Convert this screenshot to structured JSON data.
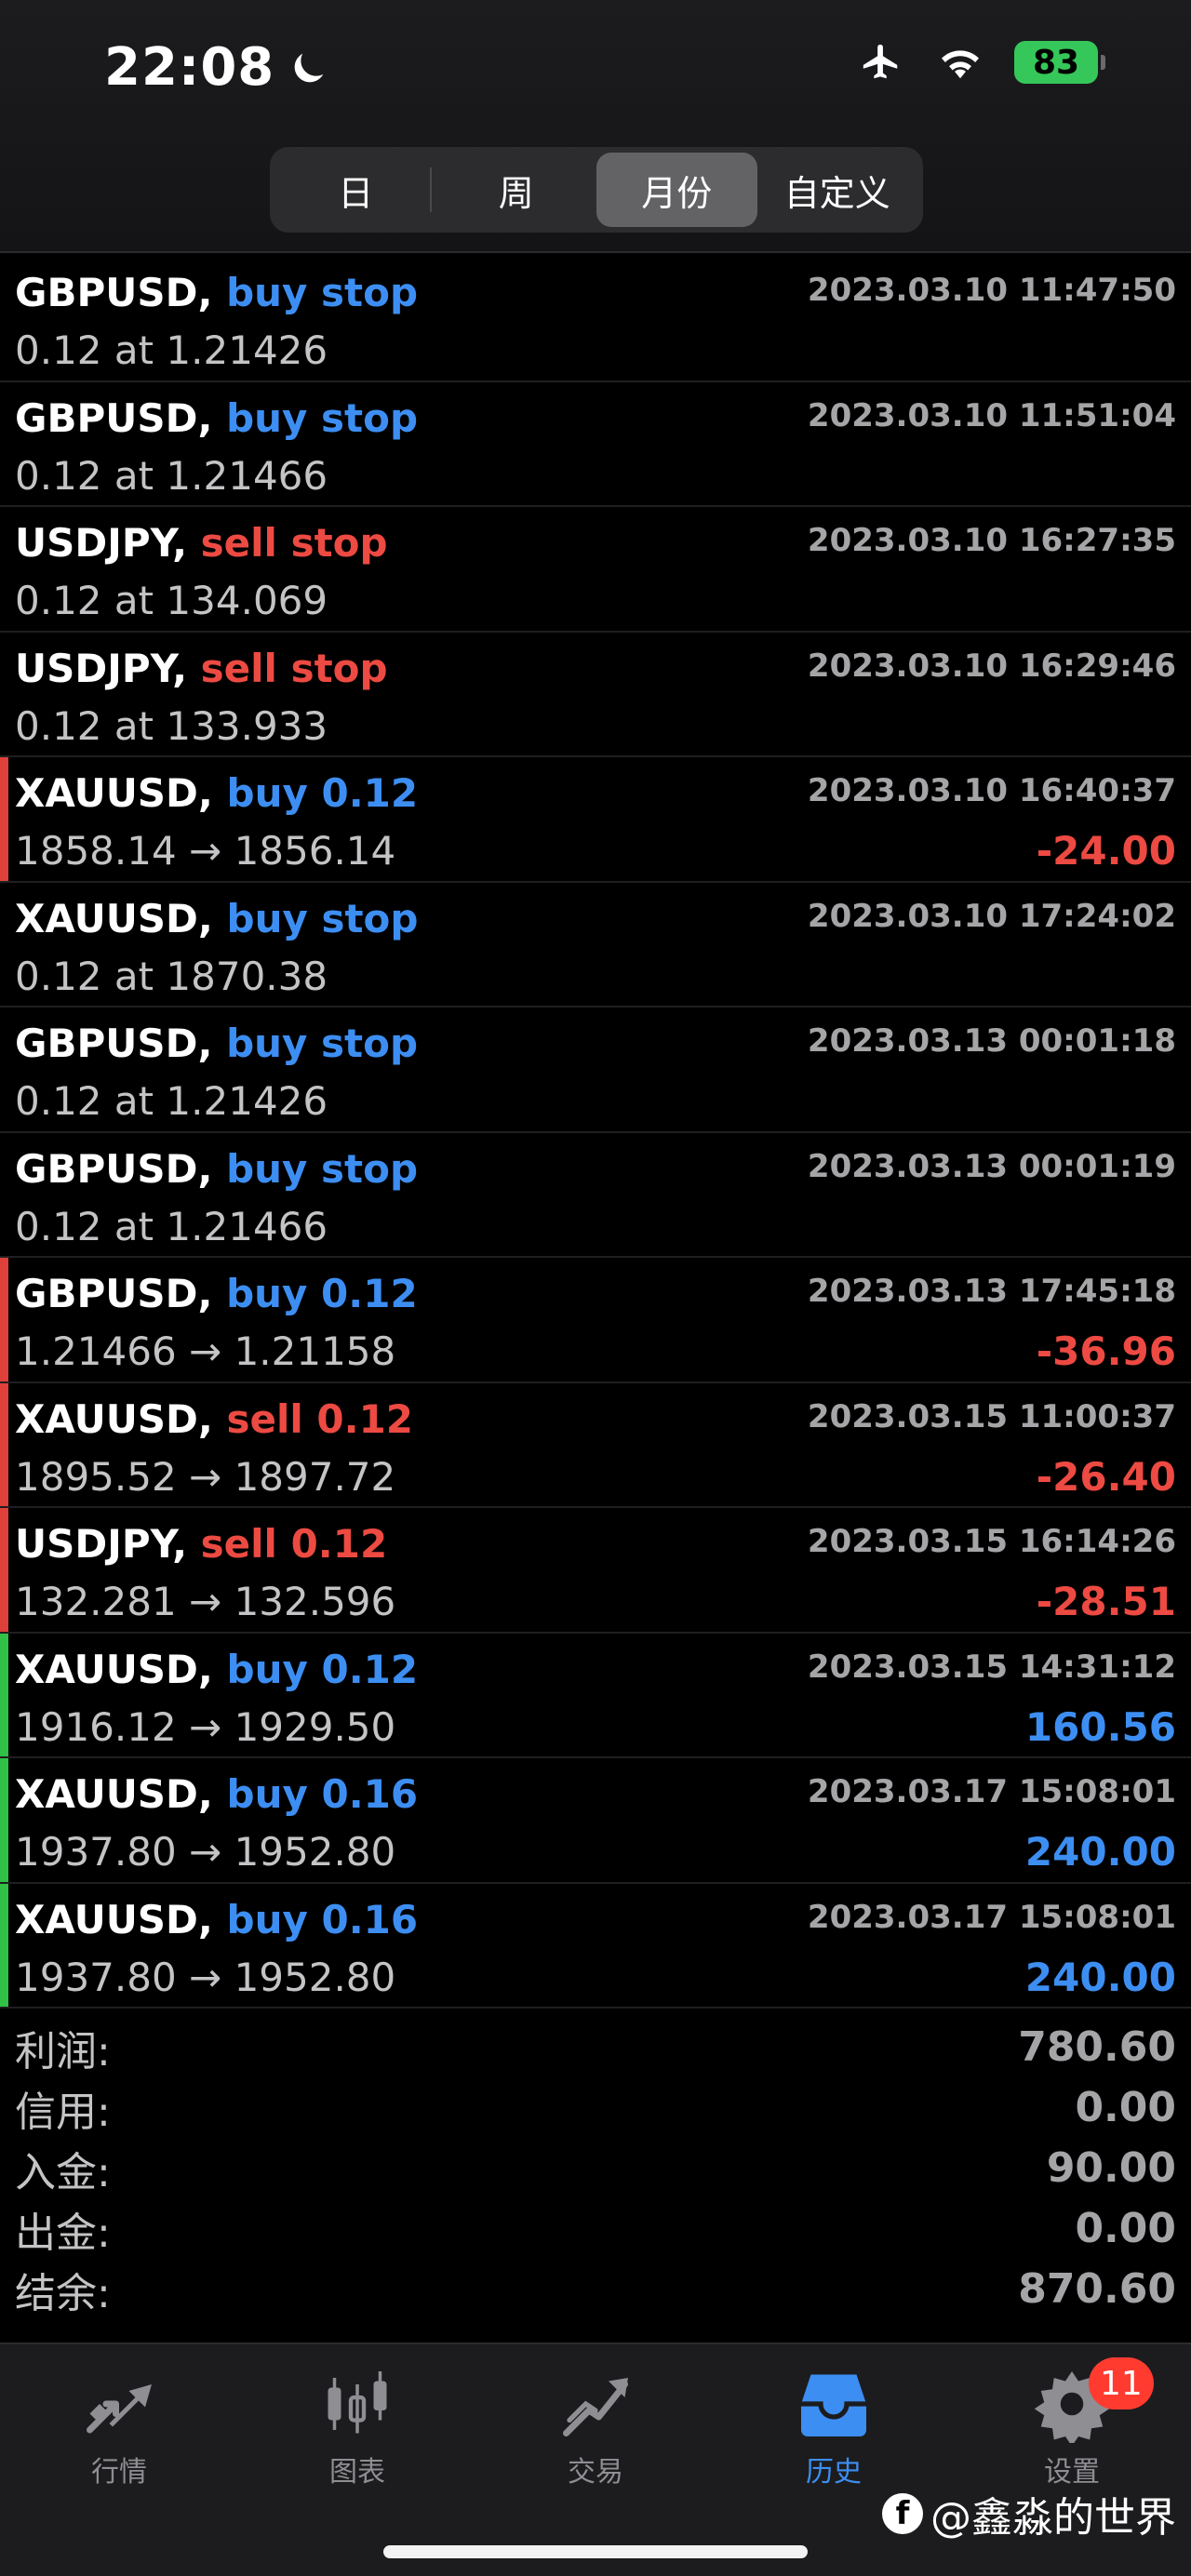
{
  "status": {
    "time": "22:08",
    "battery": "83"
  },
  "segments": [
    {
      "label": "日",
      "active": false
    },
    {
      "label": "周",
      "active": false
    },
    {
      "label": "月份",
      "active": true
    },
    {
      "label": "自定义",
      "active": false
    }
  ],
  "trades": [
    {
      "symbol": "GBPUSD,",
      "op": "buy stop",
      "op_color": "blue",
      "detail": "0.12 at 1.21426",
      "time": "2023.03.10 11:47:50",
      "profit": "",
      "profit_color": "",
      "marker": ""
    },
    {
      "symbol": "GBPUSD,",
      "op": "buy stop",
      "op_color": "blue",
      "detail": "0.12 at 1.21466",
      "time": "2023.03.10 11:51:04",
      "profit": "",
      "profit_color": "",
      "marker": ""
    },
    {
      "symbol": "USDJPY,",
      "op": "sell stop",
      "op_color": "red",
      "detail": "0.12 at 134.069",
      "time": "2023.03.10 16:27:35",
      "profit": "",
      "profit_color": "",
      "marker": ""
    },
    {
      "symbol": "USDJPY,",
      "op": "sell stop",
      "op_color": "red",
      "detail": "0.12 at 133.933",
      "time": "2023.03.10 16:29:46",
      "profit": "",
      "profit_color": "",
      "marker": ""
    },
    {
      "symbol": "XAUUSD,",
      "op": "buy 0.12",
      "op_color": "blue",
      "detail": "1858.14 → 1856.14",
      "time": "2023.03.10 16:40:37",
      "profit": "-24.00",
      "profit_color": "red",
      "marker": "red"
    },
    {
      "symbol": "XAUUSD,",
      "op": "buy stop",
      "op_color": "blue",
      "detail": "0.12 at 1870.38",
      "time": "2023.03.10 17:24:02",
      "profit": "",
      "profit_color": "",
      "marker": ""
    },
    {
      "symbol": "GBPUSD,",
      "op": "buy stop",
      "op_color": "blue",
      "detail": "0.12 at 1.21426",
      "time": "2023.03.13 00:01:18",
      "profit": "",
      "profit_color": "",
      "marker": ""
    },
    {
      "symbol": "GBPUSD,",
      "op": "buy stop",
      "op_color": "blue",
      "detail": "0.12 at 1.21466",
      "time": "2023.03.13 00:01:19",
      "profit": "",
      "profit_color": "",
      "marker": ""
    },
    {
      "symbol": "GBPUSD,",
      "op": "buy 0.12",
      "op_color": "blue",
      "detail": "1.21466 → 1.21158",
      "time": "2023.03.13 17:45:18",
      "profit": "-36.96",
      "profit_color": "red",
      "marker": "red"
    },
    {
      "symbol": "XAUUSD,",
      "op": "sell 0.12",
      "op_color": "red",
      "detail": "1895.52 → 1897.72",
      "time": "2023.03.15 11:00:37",
      "profit": "-26.40",
      "profit_color": "red",
      "marker": "red"
    },
    {
      "symbol": "USDJPY,",
      "op": "sell 0.12",
      "op_color": "red",
      "detail": "132.281 → 132.596",
      "time": "2023.03.15 16:14:26",
      "profit": "-28.51",
      "profit_color": "red",
      "marker": "red"
    },
    {
      "symbol": "XAUUSD,",
      "op": "buy 0.12",
      "op_color": "blue",
      "detail": "1916.12 → 1929.50",
      "time": "2023.03.15 14:31:12",
      "profit": "160.56",
      "profit_color": "blue",
      "marker": "green"
    },
    {
      "symbol": "XAUUSD,",
      "op": "buy 0.16",
      "op_color": "blue",
      "detail": "1937.80 → 1952.80",
      "time": "2023.03.17 15:08:01",
      "profit": "240.00",
      "profit_color": "blue",
      "marker": "green"
    },
    {
      "symbol": "XAUUSD,",
      "op": "buy 0.16",
      "op_color": "blue",
      "detail": "1937.80 → 1952.80",
      "time": "2023.03.17 15:08:01",
      "profit": "240.00",
      "profit_color": "blue",
      "marker": "green"
    }
  ],
  "summary": [
    {
      "label": "利润:",
      "value": "780.60"
    },
    {
      "label": "信用:",
      "value": "0.00"
    },
    {
      "label": "入金:",
      "value": "90.00"
    },
    {
      "label": "出金:",
      "value": "0.00"
    },
    {
      "label": "结余:",
      "value": "870.60"
    }
  ],
  "tabbar": {
    "items": [
      {
        "label": "行情",
        "icon": "quotes-arrows-icon",
        "active": false
      },
      {
        "label": "图表",
        "icon": "candlestick-chart-icon",
        "active": false
      },
      {
        "label": "交易",
        "icon": "trade-trend-icon",
        "active": false
      },
      {
        "label": "历史",
        "icon": "history-inbox-icon",
        "active": true
      },
      {
        "label": "设置",
        "icon": "gear-icon",
        "active": false,
        "badge": "11"
      }
    ]
  },
  "watermark": {
    "text": "@鑫淼的世界"
  },
  "colors": {
    "buy": "#3d8ef2",
    "sell": "#ec4a42",
    "profit_marker": "#30c146",
    "loss_marker": "#e0403a",
    "active_tab": "#3d8ef2"
  }
}
